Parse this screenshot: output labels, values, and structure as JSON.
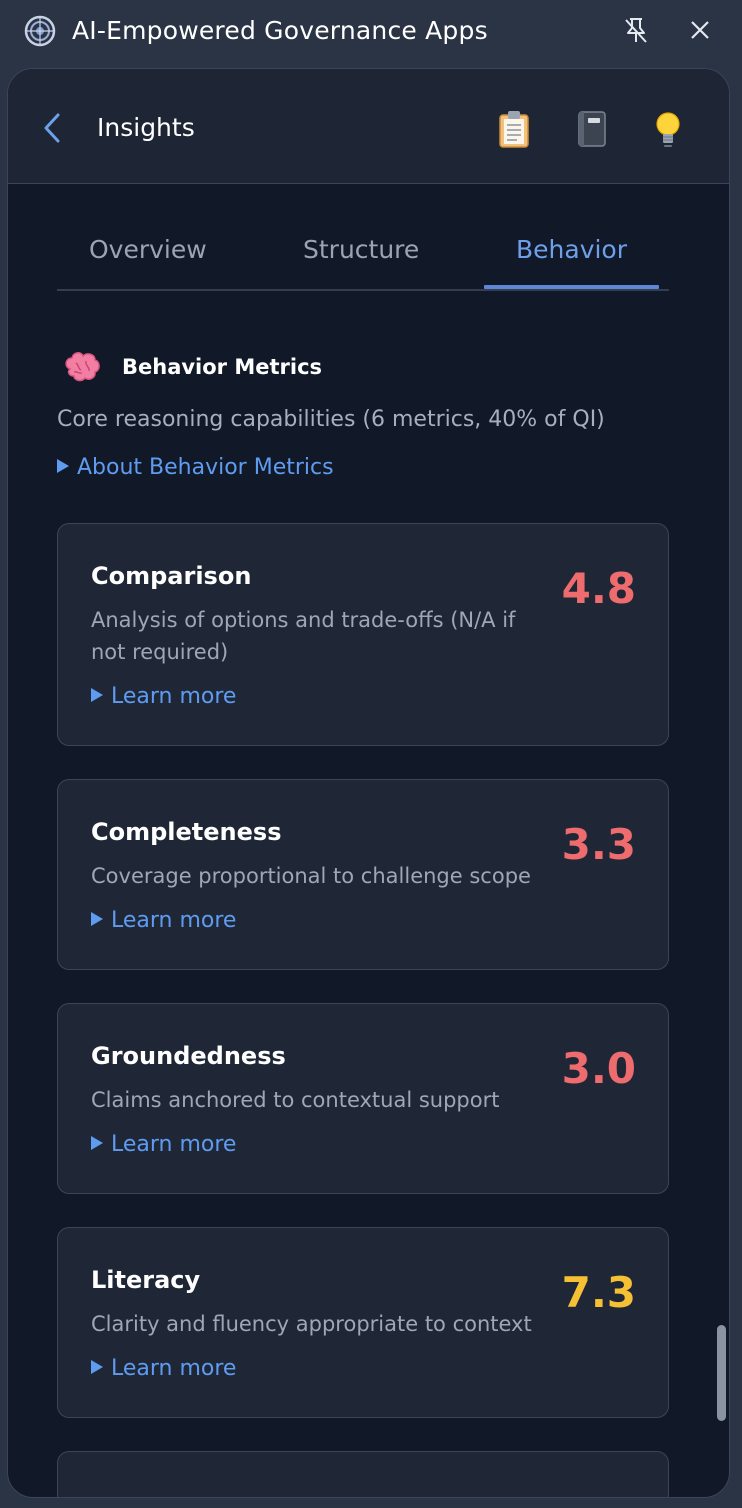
{
  "window": {
    "title": "AI-Empowered Governance Apps"
  },
  "header": {
    "title": "Insights"
  },
  "tabs": [
    {
      "label": "Overview",
      "active": false
    },
    {
      "label": "Structure",
      "active": false
    },
    {
      "label": "Behavior",
      "active": true
    }
  ],
  "section": {
    "icon": "brain-icon",
    "title": "Behavior Metrics",
    "subtitle": "Core reasoning capabilities (6 metrics, 40% of QI)",
    "about_link": "About Behavior Metrics"
  },
  "metrics": [
    {
      "name": "Comparison",
      "description": "Analysis of options and trade-offs (N/A if not required)",
      "score": "4.8",
      "score_color": "#ee6b6e",
      "learn_more": "Learn more"
    },
    {
      "name": "Completeness",
      "description": "Coverage proportional to challenge scope",
      "score": "3.3",
      "score_color": "#ee6b6e",
      "learn_more": "Learn more"
    },
    {
      "name": "Groundedness",
      "description": "Claims anchored to contextual support",
      "score": "3.0",
      "score_color": "#ee6b6e",
      "learn_more": "Learn more"
    },
    {
      "name": "Literacy",
      "description": "Clarity and fluency appropriate to context",
      "score": "7.3",
      "score_color": "#f5c033",
      "learn_more": "Learn more"
    }
  ],
  "colors": {
    "accent": "#5f9cf0",
    "background": "#111827",
    "card": "#1f2737"
  }
}
